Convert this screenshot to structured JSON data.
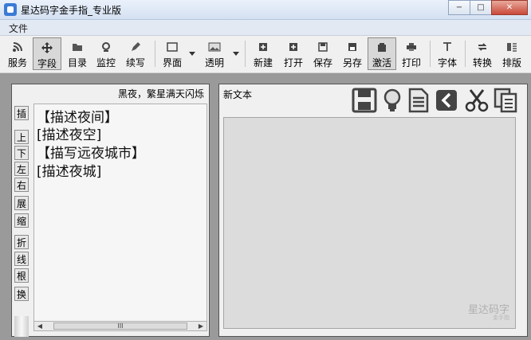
{
  "window": {
    "title": "星达码字金手指_专业版",
    "min": "−",
    "max": "□",
    "close": "✕"
  },
  "menu": {
    "file": "文件"
  },
  "toolbar": {
    "service": "服务",
    "field": "字段",
    "catalog": "目录",
    "monitor": "监控",
    "continue": "续写",
    "ui": "界面",
    "transparent": "透明",
    "new": "新建",
    "open": "打开",
    "save": "保存",
    "saveas": "另存",
    "activate": "激活",
    "print": "打印",
    "font": "字体",
    "convert": "转换",
    "layout": "排版"
  },
  "left_panel": {
    "header": "黑夜，繁星满天闪烁",
    "side_buttons": [
      "插",
      "上",
      "下",
      "左",
      "右",
      "展",
      "缩",
      "折",
      "线",
      "根",
      "换"
    ],
    "lines": [
      "【描述夜间】",
      "[描述夜空]",
      "【描写远夜城市】",
      "[描述夜城]"
    ],
    "scroll_left": "◀",
    "scroll_right": "▶",
    "scroll_grip": "III"
  },
  "right_panel": {
    "title": "新文本",
    "watermark": "星达码字",
    "watermark_sub": "金手指"
  },
  "icons": [
    "save-disk-icon",
    "idea-bulb-icon",
    "document-icon",
    "back-arrow-icon",
    "cut-scissors-icon",
    "copy-icon"
  ]
}
